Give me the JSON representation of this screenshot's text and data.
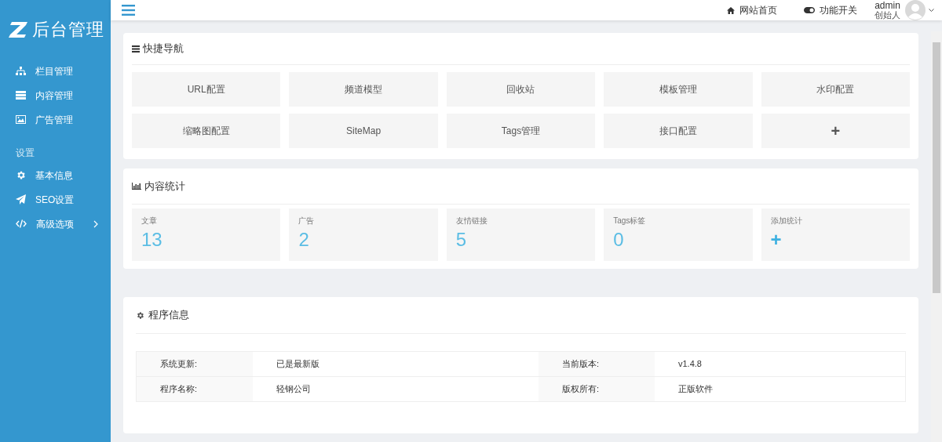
{
  "sidebar": {
    "logo": "后台管理",
    "items": [
      {
        "label": "栏目管理",
        "kind": "sitemap"
      },
      {
        "label": "内容管理",
        "kind": "list"
      },
      {
        "label": "广告管理",
        "kind": "image"
      }
    ],
    "section_title": "设置",
    "settings_items": [
      {
        "label": "基本信息",
        "kind": "gear",
        "has_submenu": false
      },
      {
        "label": "SEO设置",
        "kind": "plane",
        "has_submenu": false
      },
      {
        "label": "高级选项",
        "kind": "code",
        "has_submenu": true
      }
    ]
  },
  "header": {
    "links": [
      {
        "label": "网站首页",
        "kind": "home"
      },
      {
        "label": "功能开关",
        "kind": "toggle"
      }
    ],
    "user": {
      "name": "admin",
      "role": "创始人"
    }
  },
  "quick_nav": {
    "title": "快捷导航",
    "items": [
      {
        "label": "URL配置",
        "kind": "text"
      },
      {
        "label": "频道模型",
        "kind": "text"
      },
      {
        "label": "回收站",
        "kind": "text"
      },
      {
        "label": "模板管理",
        "kind": "text"
      },
      {
        "label": "水印配置",
        "kind": "text"
      },
      {
        "label": "缩略图配置",
        "kind": "text"
      },
      {
        "label": "SiteMap",
        "kind": "text"
      },
      {
        "label": "Tags管理",
        "kind": "text"
      },
      {
        "label": "接口配置",
        "kind": "text"
      },
      {
        "label": "+",
        "kind": "add"
      }
    ]
  },
  "stats": {
    "title": "内容统计",
    "items": [
      {
        "label": "文章",
        "value": "13",
        "kind": "count"
      },
      {
        "label": "广告",
        "value": "2",
        "kind": "count"
      },
      {
        "label": "友情链接",
        "value": "5",
        "kind": "count"
      },
      {
        "label": "Tags标签",
        "value": "0",
        "kind": "count"
      },
      {
        "label": "添加统计",
        "value": "+",
        "kind": "add"
      }
    ]
  },
  "program_info": {
    "title": "程序信息",
    "rows": [
      [
        "系统更新:",
        "已是最新版",
        "当前版本:",
        "v1.4.8"
      ],
      [
        "程序名称:",
        "轻钢公司",
        "版权所有:",
        "正版软件"
      ]
    ]
  }
}
